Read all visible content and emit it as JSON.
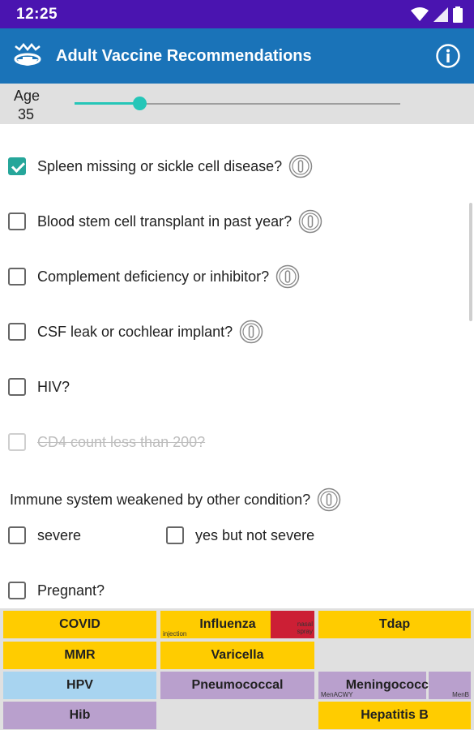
{
  "status_bar": {
    "time": "12:25"
  },
  "app_bar": {
    "title": "Adult Vaccine Recommendations"
  },
  "age": {
    "label": "Age",
    "value": "35",
    "slider_fraction": 0.2
  },
  "questions": [
    {
      "text": "Spleen missing or sickle cell disease?",
      "checked": true,
      "has_info": true
    },
    {
      "text": "Blood stem cell transplant in past year?",
      "checked": false,
      "has_info": true
    },
    {
      "text": "Complement deficiency or inhibitor?",
      "checked": false,
      "has_info": true
    },
    {
      "text": "CSF leak or cochlear implant?",
      "checked": false,
      "has_info": true
    },
    {
      "text": "HIV?",
      "checked": false,
      "has_info": false
    },
    {
      "text": "CD4 count less than 200?",
      "checked": false,
      "disabled": true,
      "has_info": false
    }
  ],
  "immune": {
    "question": "Immune system weakened by other condition?",
    "severe": "severe",
    "not_severe": "yes but not severe"
  },
  "pregnant": "Pregnant?",
  "vaccines": {
    "covid": "COVID",
    "influenza": "Influenza",
    "influenza_injection": "injection",
    "influenza_nasal": "nasal spray",
    "tdap": "Tdap",
    "mmr": "MMR",
    "varicella": "Varicella",
    "hpv": "HPV",
    "pneumococcal": "Pneumococcal",
    "meningococcal": "Meningococcal",
    "menacwy": "MenACWY",
    "menb": "MenB",
    "hib": "Hib",
    "hepatitis_b": "Hepatitis B"
  },
  "colors": {
    "status_bar": "#4a14b0",
    "app_bar": "#1a73b8",
    "accent": "#26c6b8",
    "recommended": "#ffcc00",
    "conditional": "#b9a0cd",
    "not_recommended": "#a8d4f0",
    "contraindicated": "#cc1f35"
  }
}
